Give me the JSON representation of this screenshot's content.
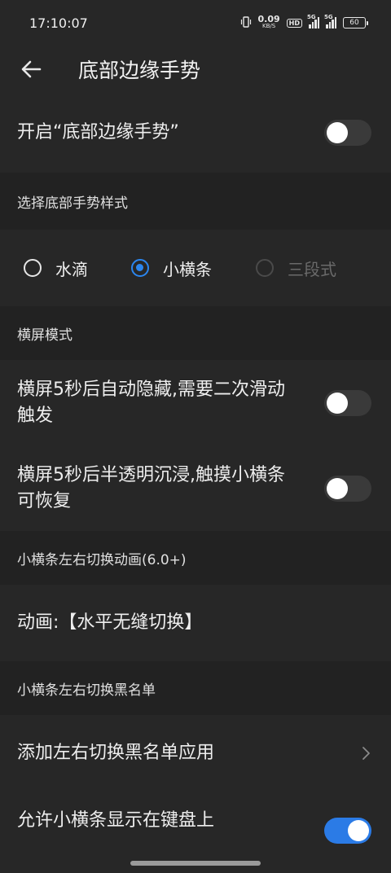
{
  "status_bar": {
    "time": "17:10:07",
    "net_speed_value": "0.09",
    "net_speed_unit": "KB/S",
    "hd_label": "HD",
    "sim1_tag": "5G",
    "sim2_tag": "5G",
    "battery": "60"
  },
  "header": {
    "title": "底部边缘手势"
  },
  "enable_gesture": {
    "label": "开启“底部边缘手势”",
    "enabled": false
  },
  "section_style": {
    "title": "选择底部手势样式"
  },
  "gesture_styles": [
    {
      "label": "水滴",
      "checked": false,
      "disabled": false
    },
    {
      "label": "小横条",
      "checked": true,
      "disabled": false
    },
    {
      "label": "三段式",
      "checked": false,
      "disabled": true
    }
  ],
  "section_landscape": {
    "title": "横屏模式"
  },
  "landscape_options": [
    {
      "label": "横屏5秒后自动隐藏,需要二次滑动触发",
      "enabled": false
    },
    {
      "label": "横屏5秒后半透明沉浸,触摸小横条可恢复",
      "enabled": false
    }
  ],
  "section_animation": {
    "title": "小横条左右切换动画(6.0+)"
  },
  "animation_row": {
    "label": "动画:【水平无缝切换】"
  },
  "section_blacklist": {
    "title": "小横条左右切换黑名单"
  },
  "blacklist_row": {
    "label": "添加左右切换黑名单应用"
  },
  "keyboard_row": {
    "label": "允许小横条显示在键盘上",
    "enabled": true
  },
  "colors": {
    "accent": "#2b7be6",
    "background": "#222222",
    "card": "#272727"
  }
}
